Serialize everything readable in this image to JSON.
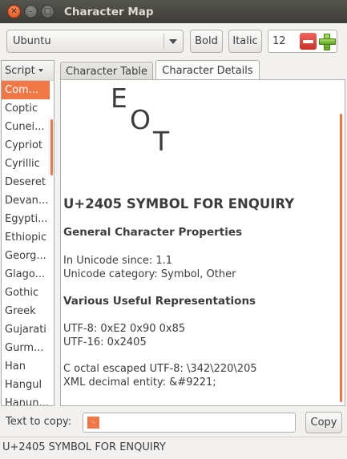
{
  "window": {
    "title": "Character Map",
    "close_glyph": "✕",
    "minimize_glyph": "–",
    "maximize_glyph": "□"
  },
  "toolbar": {
    "font_name": "Ubuntu",
    "bold_label": "Bold",
    "italic_label": "Italic",
    "font_size": "12"
  },
  "sidebar": {
    "header": "Script",
    "selected_index": 0,
    "items": [
      "Com...",
      "Coptic",
      "Cunei...",
      "Cypriot",
      "Cyrillic",
      "Deseret",
      "Devan...",
      "Egypti...",
      "Ethiopic",
      "Georg...",
      "Glago...",
      "Gothic",
      "Greek",
      "Gujarati",
      "Gurm...",
      "Han",
      "Hangul",
      "Hanun..."
    ]
  },
  "tabs": [
    {
      "label": "Character Table",
      "active": false
    },
    {
      "label": "Character Details",
      "active": true
    }
  ],
  "details": {
    "glyph_parts": [
      "E",
      "O",
      "T"
    ],
    "title": "U+2405 SYMBOL FOR ENQUIRY",
    "general_heading": "General Character Properties",
    "unicode_since": "In Unicode since: 1.1",
    "unicode_category": "Unicode category: Symbol, Other",
    "representations_heading": "Various Useful Representations",
    "utf8": "UTF-8: 0xE2 0x90 0x85",
    "utf16": "UTF-16: 0x2405",
    "c_octal": "C octal escaped UTF-8: \\342\\220\\205",
    "xml_entity": "XML decimal entity: &#9221;"
  },
  "copy": {
    "label": "Text to copy:",
    "value": "␅",
    "button_label": "Copy"
  },
  "status": {
    "text": "U+2405 SYMBOL FOR ENQUIRY"
  },
  "colors": {
    "accent": "#f07746",
    "titlebar": "#3d3c37"
  }
}
